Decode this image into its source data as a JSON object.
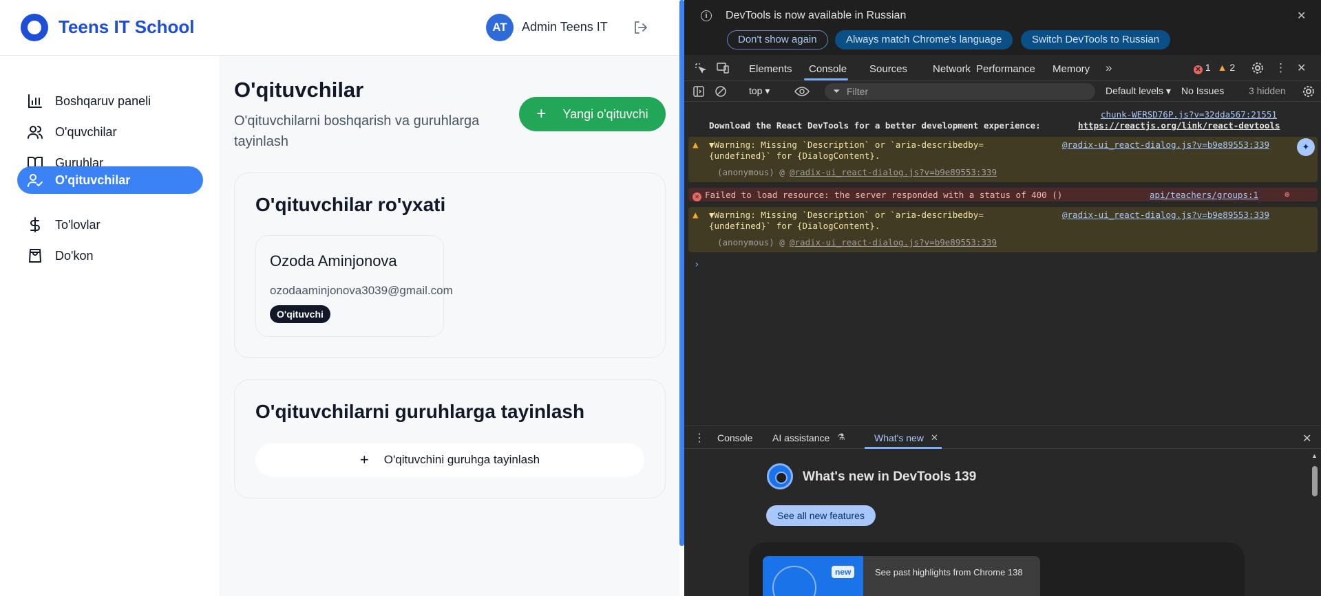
{
  "app": {
    "logo_text": "Teens IT School",
    "user": {
      "initials": "AT",
      "name": "Admin Teens IT"
    },
    "sidebar": {
      "items": [
        {
          "label": "Boshqaruv paneli",
          "icon": "bar-chart-icon",
          "active": false
        },
        {
          "label": "O'quvchilar",
          "icon": "users-icon",
          "active": false
        },
        {
          "label": "Guruhlar",
          "icon": "book-open-icon",
          "active": false
        },
        {
          "label": "O'qituvchilar",
          "icon": "user-check-icon",
          "active": true
        },
        {
          "label": "To'lovlar",
          "icon": "dollar-icon",
          "active": false
        },
        {
          "label": "Do'kon",
          "icon": "shopping-bag-icon",
          "active": false
        }
      ]
    },
    "page": {
      "title": "O'qituvchilar",
      "subtitle": "O'qituvchilarni boshqarish va guruhlarga tayinlash",
      "new_button": "Yangi o'qituvchi"
    },
    "teachers_card": {
      "title": "O'qituvchilar ro'yxati",
      "teachers": [
        {
          "name": "Ozoda Aminjonova",
          "email": "ozodaaminjonova3039@gmail.com",
          "role": "O'qituvchi"
        }
      ]
    },
    "assign_card": {
      "title": "O'qituvchilarni guruhlarga tayinlash",
      "button": "O'qituvchini guruhga tayinlash"
    },
    "colors": {
      "brand": "#1d4ed8",
      "active_nav": "#3b82f6",
      "new_button": "#22a657"
    }
  },
  "devtools": {
    "infobar": {
      "text": "DevTools is now available in Russian",
      "buttons": [
        "Don't show again",
        "Always match Chrome's language",
        "Switch DevTools to Russian"
      ]
    },
    "tabs": [
      "Elements",
      "Console",
      "Sources",
      "Network",
      "Performance",
      "Memory"
    ],
    "active_tab": "Console",
    "errors": "1",
    "warnings": "2",
    "toolbar": {
      "context": "top",
      "filter_placeholder": "Filter",
      "levels": "Default levels",
      "issues": "No Issues",
      "hidden": "3 hidden"
    },
    "console": {
      "chunk_link": "chunk-WERSD76P.js?v=32dda567:21551",
      "react_msg": "Download the React DevTools for a better development experience: ",
      "react_link": "https://reactjs.org/link/react-devtools",
      "warn1_line1": "▼Warning: Missing `Description` or `aria-describedby=",
      "warn1_line2": "{undefined}` for {DialogContent}.",
      "warn_src": "@radix-ui_react-dialog.js?v=b9e89553:339",
      "anon_prefix": "(anonymous) @ ",
      "error_msg": "Failed to load resource: the server responded with a status of 400 ()",
      "error_src": "api/teachers/groups:1",
      "warn2_line1": "▼Warning: Missing `Description` or `aria-describedby=",
      "warn2_line2": "{undefined}` for {DialogContent}."
    },
    "drawer": {
      "tabs": [
        "Console",
        "AI assistance",
        "What's new"
      ],
      "active": "What's new"
    },
    "whats_new": {
      "title": "What's new in DevTools 139",
      "see_all": "See all new features",
      "badge": "new",
      "item_text": "See past highlights from Chrome 138"
    }
  }
}
